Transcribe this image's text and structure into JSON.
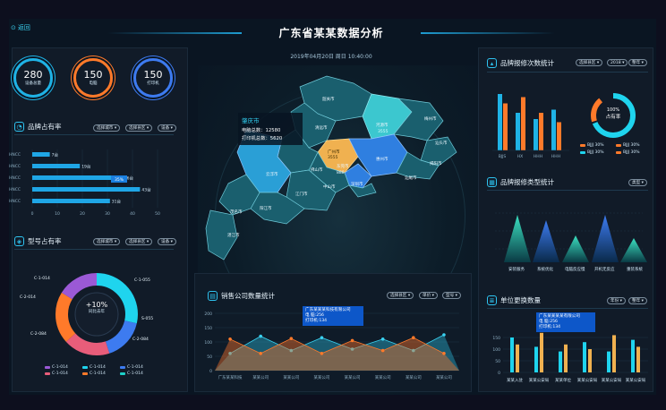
{
  "header": {
    "back_label": "返回",
    "title": "广东省某某数据分析",
    "datetime": "2019年04月20日  周日  10:40:00"
  },
  "colors": {
    "cyan": "#1fb3e6",
    "orange": "#ff7a2a",
    "blue": "#3d7bf0",
    "pink": "#e85d7a",
    "purple": "#9b59d6",
    "teal": "#1dd0c8"
  },
  "stats": [
    {
      "value": "280",
      "label": "设备总量"
    },
    {
      "value": "150",
      "label": "电脑"
    },
    {
      "value": "150",
      "label": "打印机"
    }
  ],
  "brand_share": {
    "title": "品牌占有率",
    "filters": [
      "选择城市",
      "选择县区",
      "设备"
    ],
    "categories": [
      "HNCC",
      "HNCC",
      "HNCC",
      "HNCC",
      "HNCC"
    ],
    "values": [
      7,
      19,
      36,
      43,
      31
    ],
    "value_labels": [
      "7台",
      "19台",
      "36台",
      "43台",
      "31台"
    ],
    "ticks": [
      "0",
      "10",
      "20",
      "30",
      "40",
      "50"
    ],
    "badge": "35%"
  },
  "model_share": {
    "title": "型号占有率",
    "filters": [
      "选择城市",
      "选择县区",
      "设备"
    ],
    "center_value": "+10%",
    "center_label": "同比去年",
    "slice_labels": [
      "C-1-014",
      "C-2-014",
      "C-2-084",
      "C-1-055",
      "S-055",
      "C-2-084"
    ],
    "legend": [
      {
        "name": "C-1-014",
        "icon": "purple"
      },
      {
        "name": "C-1-014",
        "icon": "pink"
      },
      {
        "name": "C-1-014",
        "icon": "cyan"
      },
      {
        "name": "C-1-014",
        "icon": "orange"
      },
      {
        "name": "C-1-014",
        "icon": "blue"
      },
      {
        "name": "C-1-014",
        "icon": "teal"
      }
    ]
  },
  "map": {
    "tooltip": {
      "city": "肇庆市",
      "line1": "电脑总数：12580",
      "line2": "打印机总数：5620"
    },
    "cities": [
      "韶关市",
      "清远市",
      "梅州市",
      "河源市",
      "广州市",
      "惠州市",
      "汕头市",
      "揭阳市",
      "汕尾市",
      "东莞市",
      "深圳市",
      "中山市",
      "佛山市",
      "江门市",
      "云浮市",
      "阳江市",
      "茂名市",
      "湛江市"
    ],
    "sub_values": [
      "3555",
      "3555",
      "888"
    ]
  },
  "sales_chart": {
    "title": "销售公司数量统计",
    "filters": [
      "选择县区",
      "单价",
      "型号"
    ],
    "tooltip": {
      "line1": "广东某某某科技有限公司",
      "line2": "电  脑:256",
      "line3": "打印机:134"
    },
    "y_ticks": [
      "200",
      "150",
      "100",
      "50",
      "0"
    ],
    "categories": [
      "广东某某科技",
      "某某公司",
      "某某公司",
      "某某公司",
      "某某公司",
      "某某公司",
      "某某公司",
      "某某公司"
    ]
  },
  "brand_repair": {
    "title": "品牌报修次数统计",
    "filters": [
      "选择县区",
      "2018",
      "整年"
    ],
    "categories": [
      "BJJS",
      "HX",
      "HHH",
      "HHH"
    ],
    "ring_value": "100%",
    "ring_label": "占有率",
    "legend": [
      {
        "name": "BJJJ  30%",
        "icon": "orange"
      },
      {
        "name": "BJJJ  30%",
        "icon": "orange"
      },
      {
        "name": "BJJJ  30%",
        "icon": "cyan"
      },
      {
        "name": "BJJJ  30%",
        "icon": "orange"
      }
    ]
  },
  "repair_type": {
    "title": "品牌报修类型统计",
    "filters": [
      "类型"
    ],
    "categories": [
      "安装服务",
      "系统优化",
      "电脑反应慢",
      "开机无反应",
      "重装系统"
    ]
  },
  "replacement": {
    "title": "单位更换数量",
    "filters": [
      "年份",
      "整年"
    ],
    "tooltip": {
      "line1": "广东某某某某有限公司",
      "line2": "电  脑:256",
      "line3": "打印机:134"
    },
    "categories": [
      "某某入驻",
      "某某公安局",
      "某某单位",
      "某某公安局",
      "某某公安局",
      "某某公安局"
    ]
  },
  "chart_data": [
    {
      "type": "bar",
      "title": "品牌占有率",
      "categories": [
        "HNCC",
        "HNCC",
        "HNCC",
        "HNCC",
        "HNCC"
      ],
      "values": [
        7,
        19,
        36,
        43,
        31
      ],
      "xlim": [
        0,
        50
      ]
    },
    {
      "type": "area",
      "title": "销售公司数量统计",
      "categories": [
        "广东某某科技",
        "某某公司",
        "某某公司",
        "某某公司",
        "某某公司",
        "某某公司",
        "某某公司",
        "某某公司"
      ],
      "series": [
        {
          "name": "电脑",
          "values": [
            60,
            120,
            70,
            115,
            75,
            110,
            70,
            125
          ]
        },
        {
          "name": "打印机",
          "values": [
            110,
            60,
            112,
            60,
            105,
            70,
            115,
            60
          ]
        }
      ],
      "ylim": [
        0,
        200
      ]
    },
    {
      "type": "bar",
      "title": "品牌报修次数统计",
      "categories": [
        "BJJS",
        "HX",
        "HHH",
        "HHH"
      ],
      "series": [
        {
          "values": [
            90,
            60,
            50,
            65
          ]
        },
        {
          "values": [
            75,
            85,
            60,
            45
          ]
        }
      ]
    },
    {
      "type": "bar",
      "title": "单位更换数量",
      "categories": [
        "某某入驻",
        "某某公安局",
        "某某单位",
        "某某公安局",
        "某某公安局",
        "某某公安局"
      ],
      "series": [
        {
          "values": [
            150,
            110,
            90,
            130,
            90,
            140
          ]
        },
        {
          "values": [
            120,
            170,
            120,
            100,
            160,
            110
          ]
        }
      ]
    }
  ]
}
